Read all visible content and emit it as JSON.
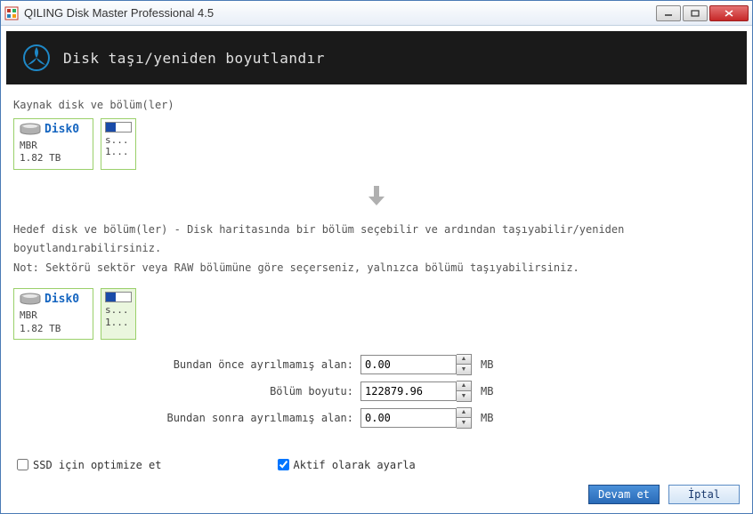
{
  "window": {
    "title": "QILING Disk Master Professional 4.5"
  },
  "header": {
    "title": "Disk taşı/yeniden boyutlandır"
  },
  "source": {
    "label": "Kaynak disk ve bölüm(ler)",
    "disk": {
      "name": "Disk0",
      "scheme": "MBR",
      "size": "1.82 TB"
    },
    "partition": {
      "line1": "s...",
      "line2": "1..."
    }
  },
  "target": {
    "help1": "Hedef disk ve bölüm(ler) - Disk haritasında bir bölüm seçebilir ve ardından taşıyabilir/yeniden boyutlandırabilirsiniz.",
    "help2": "Not: Sektörü sektör veya RAW bölümüne göre seçerseniz, yalnızca bölümü taşıyabilirsiniz.",
    "disk": {
      "name": "Disk0",
      "scheme": "MBR",
      "size": "1.82 TB"
    },
    "partition": {
      "line1": "s...",
      "line2": "1..."
    }
  },
  "form": {
    "before_label": "Bundan önce ayrılmamış alan:",
    "before_value": "0.00",
    "size_label": "Bölüm boyutu:",
    "size_value": "122879.96",
    "after_label": "Bundan sonra ayrılmamış alan:",
    "after_value": "0.00",
    "unit": "MB"
  },
  "checks": {
    "ssd_label": "SSD için optimize et",
    "ssd_checked": false,
    "active_label": "Aktif olarak ayarla",
    "active_checked": true
  },
  "footer": {
    "continue": "Devam et",
    "cancel": "İptal"
  }
}
